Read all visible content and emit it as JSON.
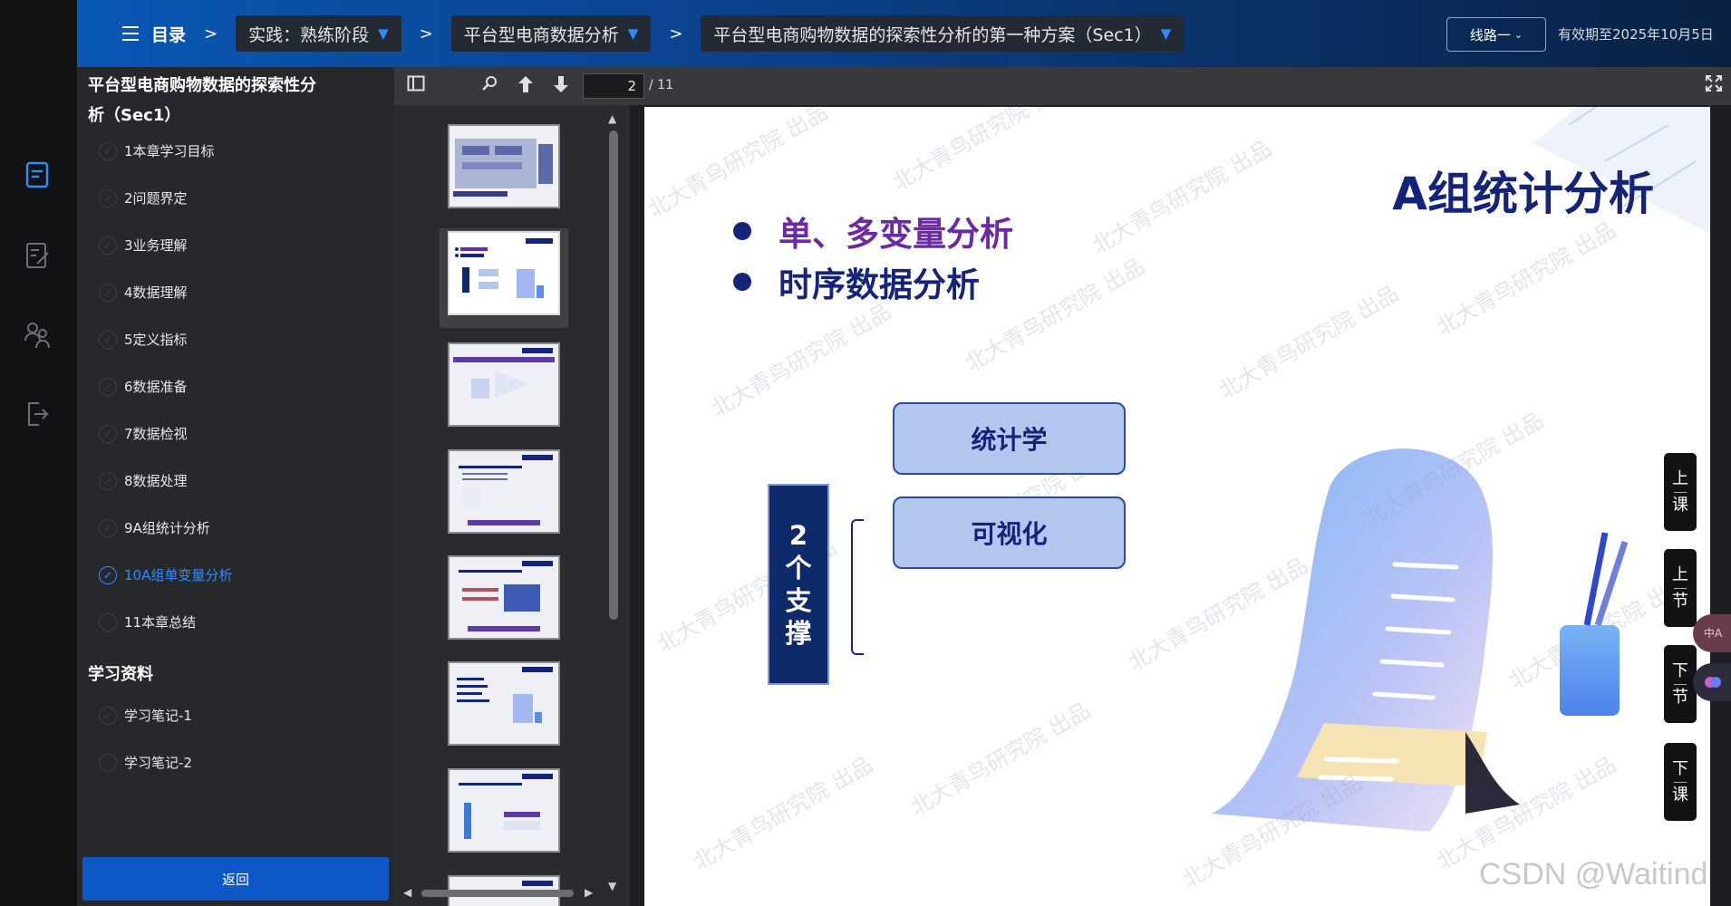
{
  "header": {
    "toc_label": "目录",
    "separator": ">",
    "breadcrumbs": [
      "实践：熟练阶段",
      "平台型电商数据分析",
      "平台型电商购物数据的探索性分析的第一种方案（Sec1）"
    ],
    "route_button": "线路一",
    "expiry": "有效期至2025年10月5日"
  },
  "rail_icons": [
    "document-icon",
    "edit-icon",
    "people-icon",
    "exit-icon"
  ],
  "sidebar": {
    "title": "平台型电商购物数据的探索性分析（Sec1）",
    "chapters": [
      "1本章学习目标",
      "2问题界定",
      "3业务理解",
      "4数据理解",
      "5定义指标",
      "6数据准备",
      "7数据检视",
      "8数据处理",
      "9A组统计分析",
      "10A组单变量分析",
      "11本章总结"
    ],
    "active_index": 9,
    "materials_heading": "学习资料",
    "materials": [
      "学习笔记-1",
      "学习笔记-2"
    ],
    "back_button": "返回"
  },
  "pdf_toolbar": {
    "current_page": "2",
    "total_pages": "/ 11"
  },
  "thumbnails": {
    "count": 8,
    "selected_index": 1
  },
  "slide": {
    "title": "A组统计分析",
    "bullets": [
      {
        "text": "单、多变量分析",
        "color": "#6b2aa5"
      },
      {
        "text": "时序数据分析",
        "color": "#16237a"
      }
    ],
    "support_label": [
      "2",
      "个",
      "支",
      "撑"
    ],
    "boxes": [
      "统计学",
      "可视化"
    ],
    "watermark": "北大青鸟研究院 出品"
  },
  "side_buttons": [
    [
      "上",
      "课"
    ],
    [
      "上",
      "节"
    ],
    [
      "下",
      "节"
    ],
    [
      "下",
      "课"
    ]
  ],
  "footer_watermark": "CSDN @Waitind",
  "colors": {
    "accent": "#2f8cff",
    "navy": "#16237a",
    "back_button": "#0d58c6"
  }
}
